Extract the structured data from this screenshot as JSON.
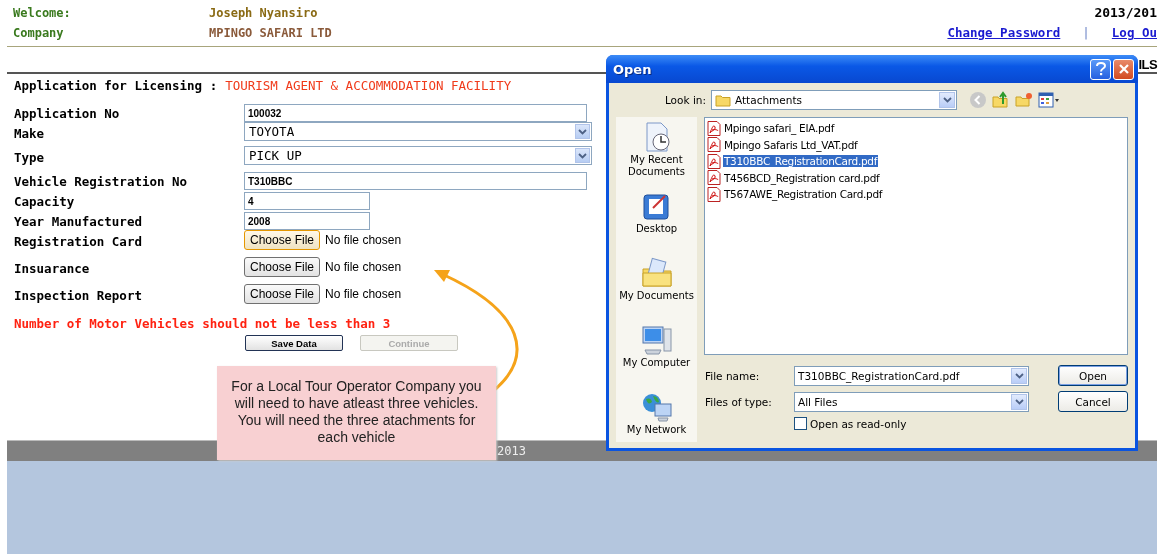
{
  "header": {
    "welcome_label": "Welcome:",
    "user_name": "Joseph Nyansiro",
    "company_label": "Company",
    "company_name": "MPINGO SAFARI LTD",
    "period": "2013/201",
    "links": [
      {
        "label": "Change Password"
      },
      {
        "label": "Log Ou"
      }
    ],
    "separator": "|"
  },
  "heading_fragment": "ILS",
  "form": {
    "title_label": "Application for Licensing :",
    "title_value": "TOURISM AGENT & ACCOMMODATION FACILITY",
    "fields": [
      {
        "kind": "text",
        "label": "Application No",
        "value": "100032"
      },
      {
        "kind": "select",
        "label": "Make",
        "value": "TOYOTA"
      },
      {
        "kind": "select",
        "label": "Type",
        "value": "PICK UP"
      },
      {
        "kind": "text",
        "label": "Vehicle Registration No",
        "value": "T310BBC"
      },
      {
        "kind": "number",
        "label": "Capacity",
        "value": "4"
      },
      {
        "kind": "number",
        "label": "Year Manufactured",
        "value": "2008"
      },
      {
        "kind": "file",
        "label": "Registration Card",
        "button": "Choose File",
        "status": "No file chosen",
        "focused": true
      },
      {
        "kind": "file",
        "label": "Insuarance",
        "button": "Choose File",
        "status": "No file chosen",
        "focused": false
      },
      {
        "kind": "file",
        "label": "Inspection Report",
        "button": "Choose File",
        "status": "No file chosen",
        "focused": false
      }
    ],
    "error": "Number of Motor Vehicles should not be less than 3",
    "buttons": [
      {
        "label": "Save Data",
        "disabled": false
      },
      {
        "label": "Continue",
        "disabled": true
      }
    ]
  },
  "footer": {
    "text": "2013"
  },
  "callout": {
    "text": "For a Local Tour Operator Company you will need to have atleast three vehicles. You will need the three atachments for each vehicle"
  },
  "dialog": {
    "title": "Open",
    "look_in_label": "Look in:",
    "look_in_value": "Attachments",
    "places": [
      {
        "kind": "recent",
        "label": "My Recent Documents"
      },
      {
        "kind": "desktop",
        "label": "Desktop"
      },
      {
        "kind": "documents",
        "label": "My Documents"
      },
      {
        "kind": "computer",
        "label": "My Computer"
      },
      {
        "kind": "network",
        "label": "My Network"
      }
    ],
    "files": [
      {
        "name": "Mpingo safari_ EIA.pdf",
        "selected": false
      },
      {
        "name": "Mpingo Safaris Ltd_VAT.pdf",
        "selected": false
      },
      {
        "name": "T310BBC_RegistrationCard.pdf",
        "selected": true
      },
      {
        "name": "T456BCD_Registration card.pdf",
        "selected": false
      },
      {
        "name": "T567AWE_Registration Card.pdf",
        "selected": false
      }
    ],
    "file_name_label": "File name:",
    "file_name_value": "T310BBC_RegistrationCard.pdf",
    "file_type_label": "Files of type:",
    "file_type_value": "All Files",
    "read_only_label": "Open as read-only",
    "read_only_checked": false,
    "buttons": [
      {
        "label": "Open",
        "default": true
      },
      {
        "label": "Cancel",
        "default": false
      }
    ]
  }
}
